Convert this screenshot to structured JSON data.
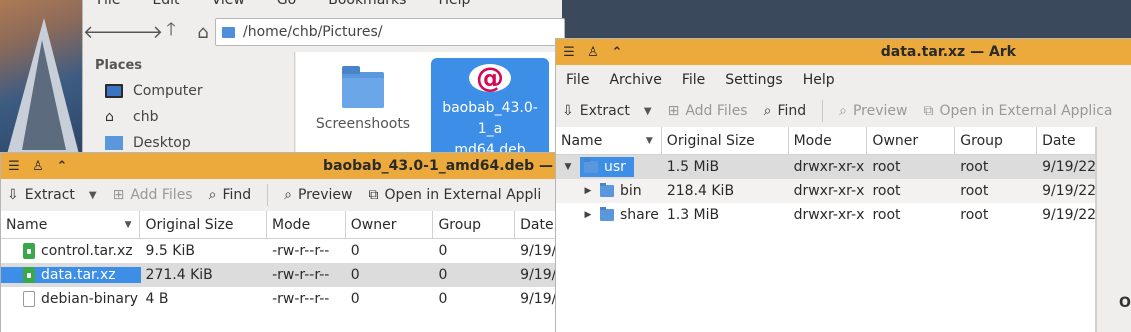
{
  "file_manager": {
    "menu": [
      "File",
      "Edit",
      "View",
      "Go",
      "Bookmarks",
      "Help"
    ],
    "location": "/home/chb/Pictures/",
    "places_heading": "Places",
    "places": [
      "Computer",
      "chb",
      "Desktop"
    ],
    "items": [
      {
        "label": "Screenshoots"
      },
      {
        "label": "baobab_43.0-1_a\nmd64.deb"
      }
    ]
  },
  "ark_back": {
    "title": "baobab_43.0-1_amd64.deb —",
    "toolbar": {
      "extract": "Extract",
      "add_files": "Add Files",
      "find": "Find",
      "preview": "Preview",
      "open_external": "Open in External Appli"
    },
    "columns": [
      "Name",
      "Original Size",
      "Mode",
      "Owner",
      "Group",
      "Date"
    ],
    "rows": [
      {
        "name": "control.tar.xz",
        "size": "9.5 KiB",
        "mode": "-rw-r--r--",
        "owner": "0",
        "group": "0",
        "date": "9/19/"
      },
      {
        "name": "data.tar.xz",
        "size": "271.4 KiB",
        "mode": "-rw-r--r--",
        "owner": "0",
        "group": "0",
        "date": "9/19/"
      },
      {
        "name": "debian-binary",
        "size": "4 B",
        "mode": "-rw-r--r--",
        "owner": "0",
        "group": "0",
        "date": "9/19/"
      }
    ]
  },
  "ark_front": {
    "title": "data.tar.xz — Ark",
    "menu": [
      "File",
      "Archive",
      "File",
      "Settings",
      "Help"
    ],
    "toolbar": {
      "extract": "Extract",
      "add_files": "Add Files",
      "find": "Find",
      "preview": "Preview",
      "open_external": "Open in External Applica"
    },
    "columns": [
      "Name",
      "Original Size",
      "Mode",
      "Owner",
      "Group",
      "Date"
    ],
    "rows": [
      {
        "name": "usr",
        "size": "1.5 MiB",
        "mode": "drwxr-xr-x",
        "owner": "root",
        "group": "root",
        "date": "9/19/22"
      },
      {
        "name": "bin",
        "size": "218.4 KiB",
        "mode": "drwxr-xr-x",
        "owner": "root",
        "group": "root",
        "date": "9/19/22"
      },
      {
        "name": "share",
        "size": "1.3 MiB",
        "mode": "drwxr-xr-x",
        "owner": "root",
        "group": "root",
        "date": "9/19/22"
      }
    ],
    "side_partial": "O"
  },
  "colors": {
    "titlebar": "#ecaa3c",
    "selection": "#3d8ee6"
  }
}
